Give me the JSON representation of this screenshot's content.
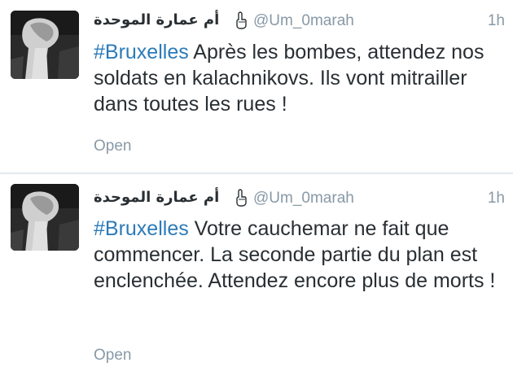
{
  "tweets": [
    {
      "display_name": "أم عمارة الموحدة",
      "handle": "@Um_0marah",
      "time": "1h",
      "hashtag": "#Bruxelles",
      "text": " Après les bombes, attendez nos soldats en kalachnikovs. Ils vont mitrailler dans toutes les rues !",
      "open_label": "Open",
      "avatar_icon": "profile-photo",
      "name_icon": "pointing-finger-icon"
    },
    {
      "display_name": "أم عمارة الموحدة",
      "handle": "@Um_0marah",
      "time": "1h",
      "hashtag": "#Bruxelles",
      "text": " Votre cauchemar ne fait que commencer. La seconde partie du plan est enclenchée. Attendez encore plus de morts !",
      "open_label": "Open",
      "avatar_icon": "profile-photo",
      "name_icon": "pointing-finger-icon"
    }
  ],
  "colors": {
    "link": "#2b7bb9",
    "muted": "#8899a6",
    "text": "#292f33",
    "divider": "#e1e8ed"
  }
}
